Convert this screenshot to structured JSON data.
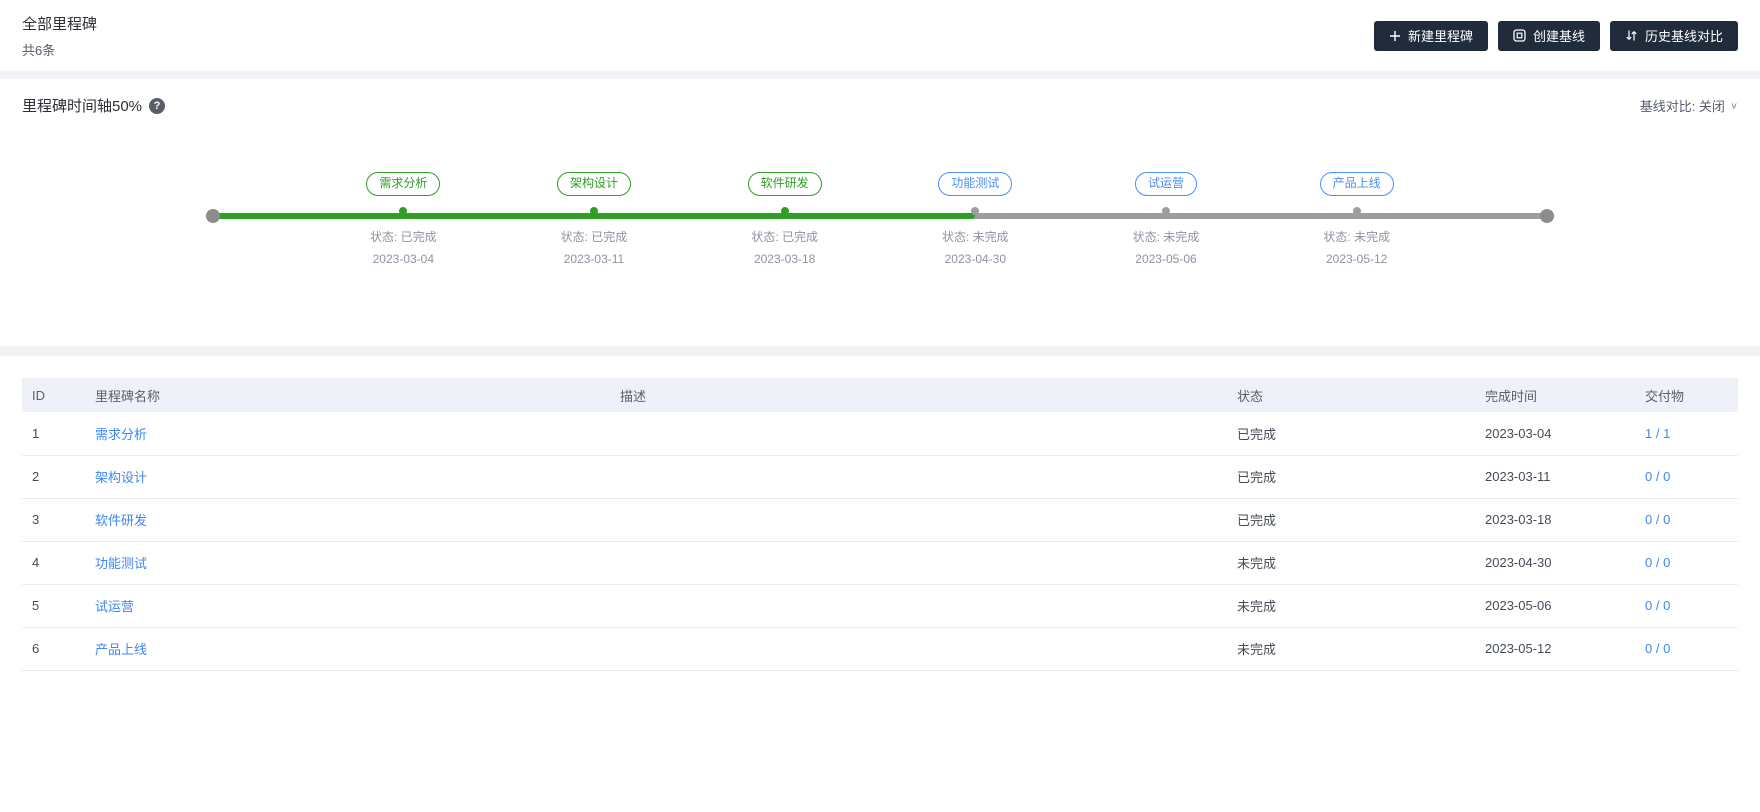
{
  "header": {
    "title": "全部里程碑",
    "count": "共6条",
    "buttons": [
      {
        "label": "新建里程碑",
        "icon": "plus-icon"
      },
      {
        "label": "创建基线",
        "icon": "baseline-icon"
      },
      {
        "label": "历史基线对比",
        "icon": "compare-icon"
      }
    ]
  },
  "timeline": {
    "title": "里程碑时间轴50%",
    "help_icon": "?",
    "progress_percent": 50,
    "baseline_toggle_label": "基线对比: 关闭",
    "milestones": [
      {
        "name": "需求分析",
        "status": "状态: 已完成",
        "date": "2023-03-04",
        "state": "done"
      },
      {
        "name": "架构设计",
        "status": "状态: 已完成",
        "date": "2023-03-11",
        "state": "done"
      },
      {
        "name": "软件研发",
        "status": "状态: 已完成",
        "date": "2023-03-18",
        "state": "done"
      },
      {
        "name": "功能测试",
        "status": "状态: 未完成",
        "date": "2023-04-30",
        "state": "todo"
      },
      {
        "name": "试运营",
        "status": "状态: 未完成",
        "date": "2023-05-06",
        "state": "todo"
      },
      {
        "name": "产品上线",
        "status": "状态: 未完成",
        "date": "2023-05-12",
        "state": "todo"
      }
    ]
  },
  "table": {
    "columns": [
      "ID",
      "里程碑名称",
      "描述",
      "状态",
      "完成时间",
      "交付物"
    ],
    "rows": [
      {
        "id": "1",
        "name": "需求分析",
        "desc": "",
        "status": "已完成",
        "date": "2023-03-04",
        "deliverable": "1 / 1"
      },
      {
        "id": "2",
        "name": "架构设计",
        "desc": "",
        "status": "已完成",
        "date": "2023-03-11",
        "deliverable": "0 / 0"
      },
      {
        "id": "3",
        "name": "软件研发",
        "desc": "",
        "status": "已完成",
        "date": "2023-03-18",
        "deliverable": "0 / 0"
      },
      {
        "id": "4",
        "name": "功能测试",
        "desc": "",
        "status": "未完成",
        "date": "2023-04-30",
        "deliverable": "0 / 0"
      },
      {
        "id": "5",
        "name": "试运营",
        "desc": "",
        "status": "未完成",
        "date": "2023-05-06",
        "deliverable": "0 / 0"
      },
      {
        "id": "6",
        "name": "产品上线",
        "desc": "",
        "status": "未完成",
        "date": "2023-05-12",
        "deliverable": "0 / 0"
      }
    ]
  },
  "colors": {
    "done_green": "#2f9e27",
    "todo_blue": "#4a8df5",
    "button_dark": "#202c3c",
    "link_blue": "#3d87f5",
    "line_gray": "#9e9e9e",
    "page_bg": "#f0f2f5",
    "table_header_bg": "#eef1f7"
  }
}
